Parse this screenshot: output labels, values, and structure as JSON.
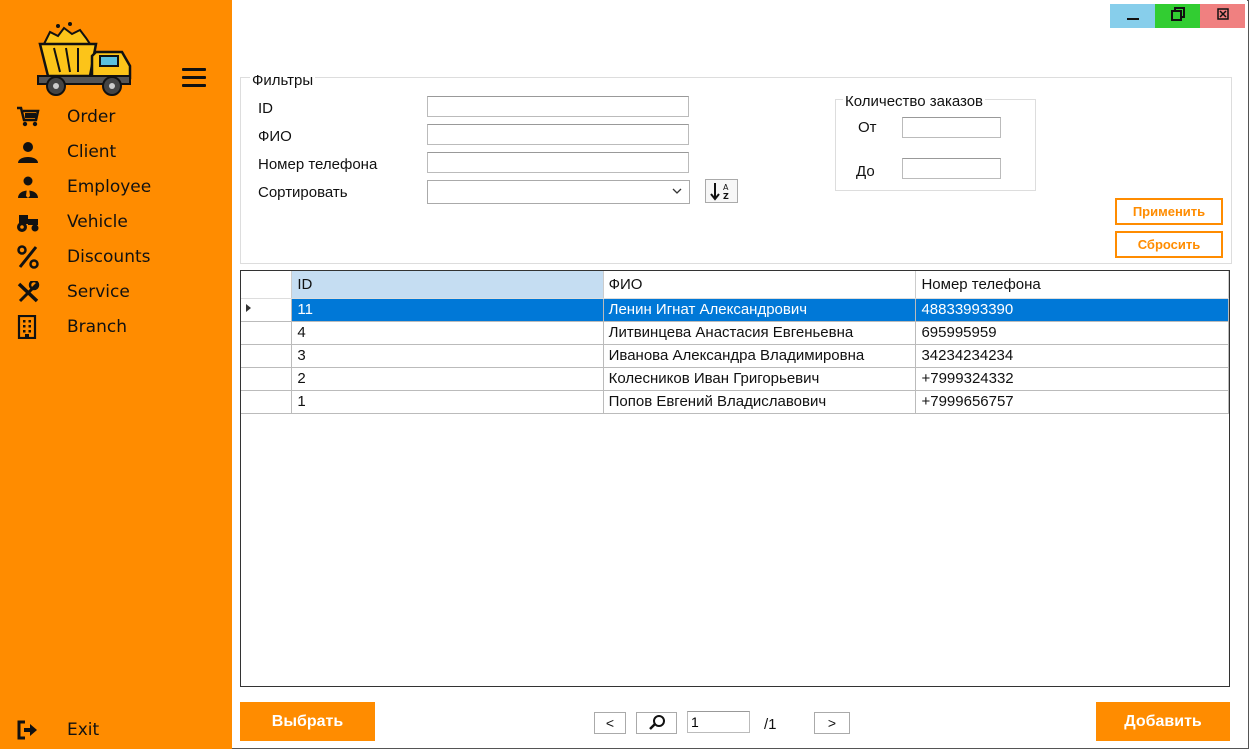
{
  "sidebar": {
    "items": [
      {
        "label": "Order",
        "icon": "cart-icon"
      },
      {
        "label": "Client",
        "icon": "user-icon"
      },
      {
        "label": "Employee",
        "icon": "employee-icon"
      },
      {
        "label": "Vehicle",
        "icon": "tractor-icon"
      },
      {
        "label": "Discounts",
        "icon": "percent-icon"
      },
      {
        "label": "Service",
        "icon": "tools-icon"
      },
      {
        "label": "Branch",
        "icon": "building-icon"
      }
    ],
    "exit_label": "Exit",
    "accent_color": "#ff8c00"
  },
  "window_controls": {
    "minimize_color": "#87ceeb",
    "maximize_color": "#32cd32",
    "close_color": "#f08080"
  },
  "filters": {
    "legend": "Фильтры",
    "id_label": "ID",
    "id_value": "",
    "fio_label": "ФИО",
    "fio_value": "",
    "phone_label": "Номер телефона",
    "phone_value": "",
    "sort_label": "Сортировать",
    "sort_value": "",
    "count": {
      "legend": "Количество заказов",
      "from_label": "От",
      "from_value": "",
      "to_label": "До",
      "to_value": ""
    },
    "apply_label": "Применить",
    "reset_label": "Сбросить"
  },
  "table": {
    "columns": [
      "ID",
      "ФИО",
      "Номер телефона"
    ],
    "rows": [
      {
        "id": "11",
        "fio": "Ленин Игнат Александрович",
        "phone": "48833993390"
      },
      {
        "id": "4",
        "fio": "Литвинцева Анастасия Евгеньевна",
        "phone": "695995959"
      },
      {
        "id": "3",
        "fio": "Иванова Александра Владимировна",
        "phone": "34234234234"
      },
      {
        "id": "2",
        "fio": "Колесников Иван Григорьевич",
        "phone": "+7999324332"
      },
      {
        "id": "1",
        "fio": "Попов Евгений Владиславович",
        "phone": "+7999656757"
      }
    ],
    "selected_row": 0,
    "selection_color": "#0078d7"
  },
  "footer": {
    "select_label": "Выбрать",
    "prev_label": "<",
    "next_label": ">",
    "page_value": "1",
    "total_pages": "/1",
    "add_label": "Добавить"
  }
}
